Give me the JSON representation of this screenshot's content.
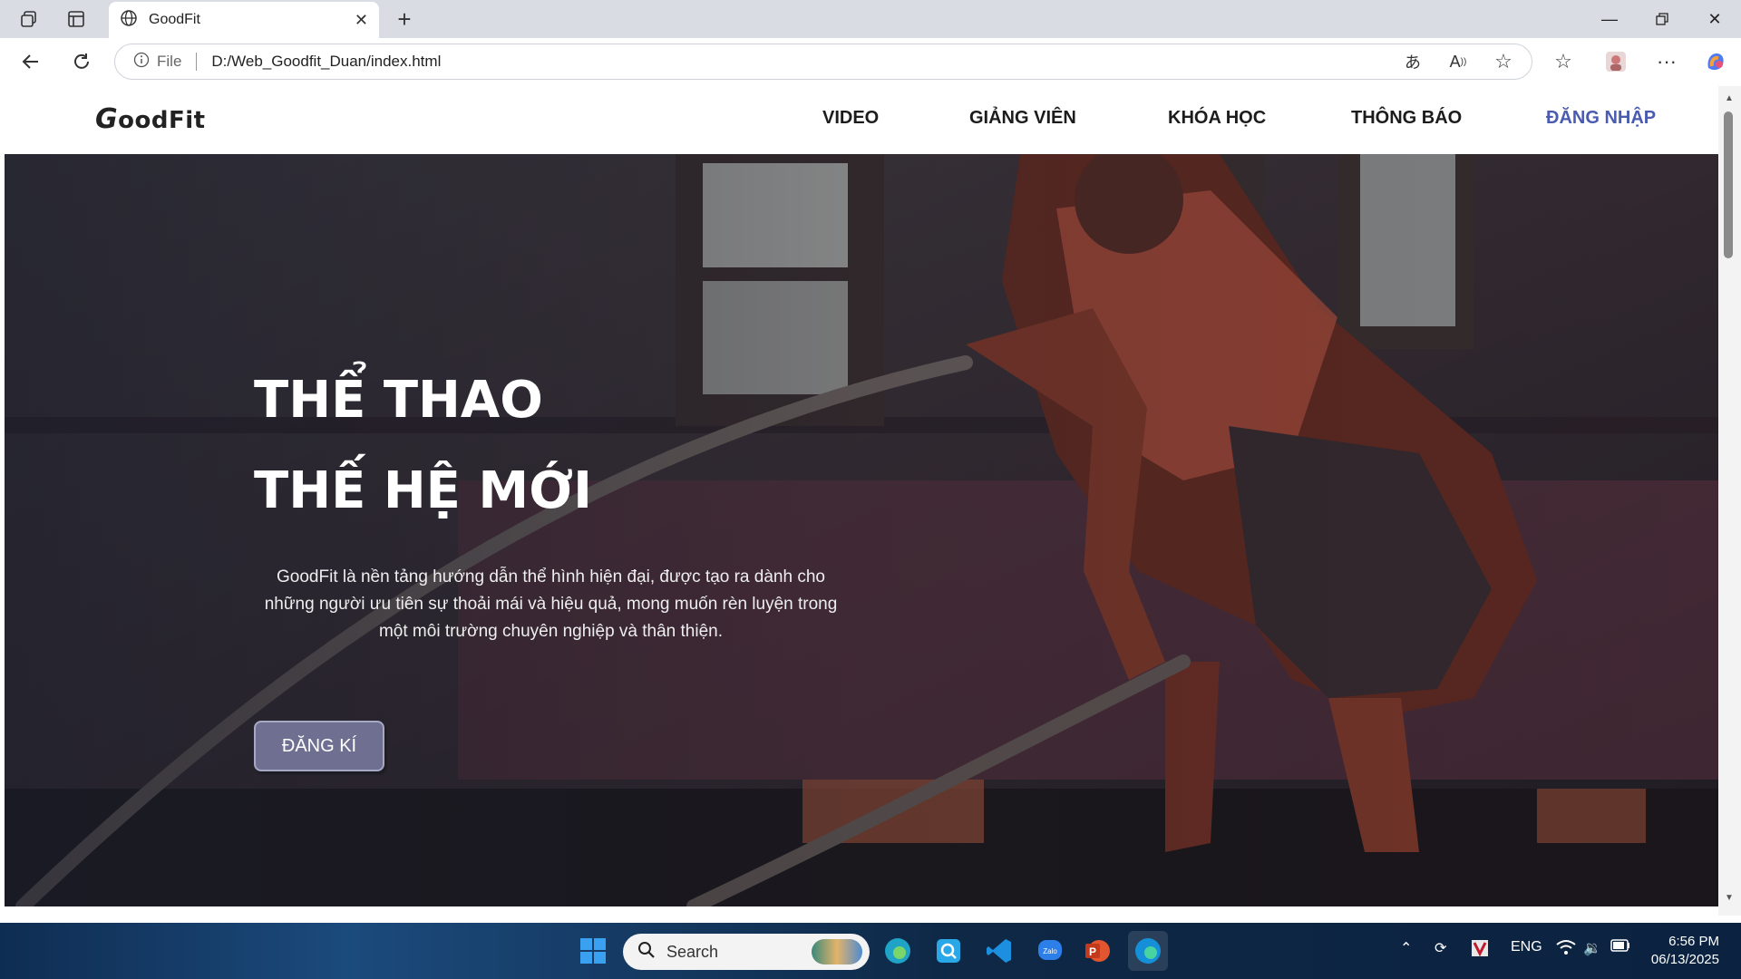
{
  "browser": {
    "tab_title": "GoodFit",
    "address_scheme": "File",
    "address_url": "D:/Web_Goodfit_Duan/index.html"
  },
  "site": {
    "logo_mark": "G",
    "logo_rest": "oodFit",
    "nav": {
      "video": "VIDEO",
      "instructors": "GIẢNG VIÊN",
      "courses": "KHÓA HỌC",
      "notices": "THÔNG BÁO",
      "login": "ĐĂNG NHẬP"
    },
    "hero": {
      "headline_line1": "THỂ THAO",
      "headline_line2": "THẾ HỆ MỚI",
      "description": "GoodFit là nền tảng hướng dẫn thể hình hiện đại, được tạo ra dành cho những người ưu tiên sự thoải mái và hiệu quả, mong muốn rèn luyện trong một môi trường chuyên nghiệp và thân thiện.",
      "cta_label": "ĐĂNG KÍ"
    }
  },
  "taskbar": {
    "search_placeholder": "Search",
    "language": "ENG",
    "time": "6:56 PM",
    "date": "06/13/2025"
  },
  "colors": {
    "login_accent": "#4a5bb0",
    "cta_bg": "#6f7091"
  }
}
